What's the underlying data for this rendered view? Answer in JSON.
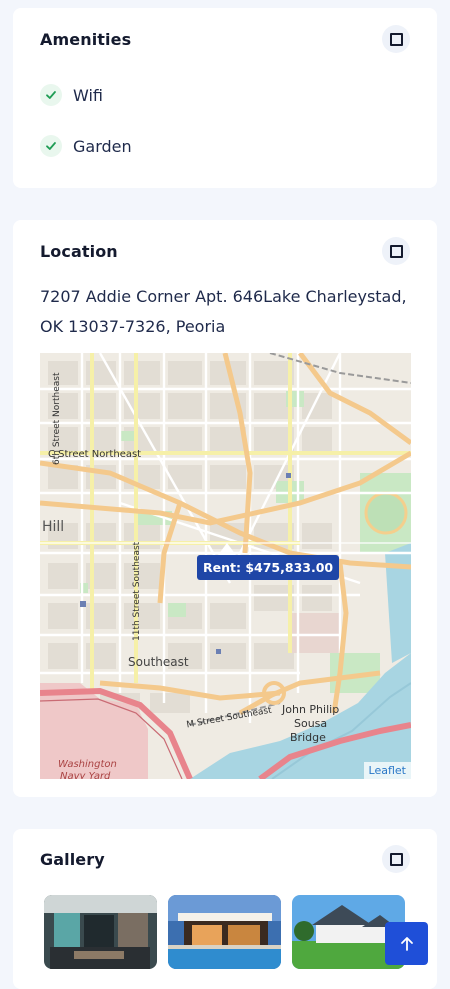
{
  "amenities": {
    "title": "Amenities",
    "items": [
      {
        "label": "Wifi"
      },
      {
        "label": "Garden"
      }
    ]
  },
  "location": {
    "title": "Location",
    "address": "7207 Addie Corner Apt. 646Lake Charleystad, OK 13037-7326, Peoria",
    "map": {
      "marker_label": "Rent: $475,833.00",
      "attribution": "Leaflet",
      "labels": {
        "street_6th": "6th Street Northeast",
        "c_street": "C Street Northeast",
        "hill": "Hill",
        "street_11th": "11th Street Southeast",
        "southeast": "Southeast",
        "m_street": "M Street Southeast",
        "bridge_1": "John Philip",
        "bridge_2": "Sousa",
        "bridge_3": "Bridge",
        "navy_1": "Washington",
        "navy_2": "Navy Yard"
      }
    }
  },
  "gallery": {
    "title": "Gallery",
    "images": [
      {
        "subject": "interior-living-room"
      },
      {
        "subject": "modern-house-pool"
      },
      {
        "subject": "white-house-lawn"
      }
    ]
  },
  "icons": {
    "check": "check-icon",
    "toggle": "square-icon",
    "scroll_top": "arrow-up-icon"
  },
  "colors": {
    "accent": "#1f4fd8",
    "marker": "#1f46a7",
    "check": "#1f9d55",
    "background": "#f3f6fc"
  }
}
